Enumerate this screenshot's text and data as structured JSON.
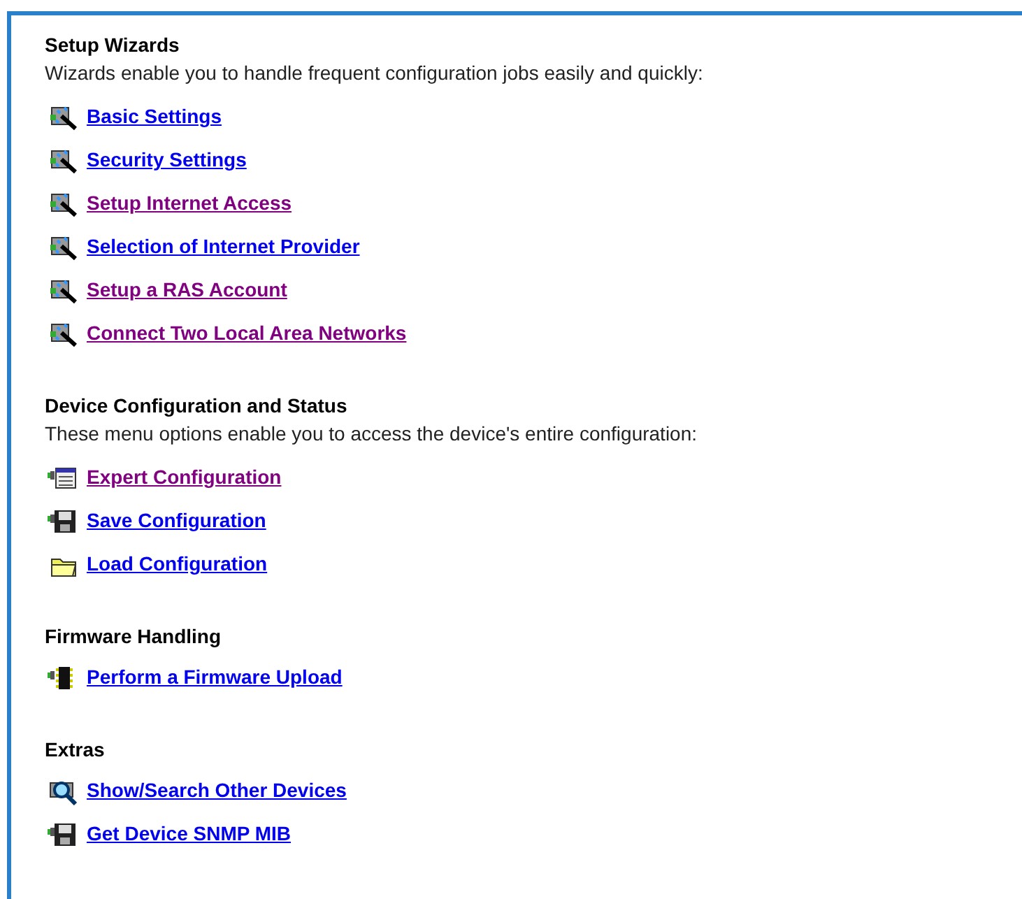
{
  "sections": [
    {
      "heading": "Setup Wizards",
      "description": "Wizards enable you to handle frequent configuration jobs easily and quickly:",
      "links": [
        {
          "label": "Basic Settings",
          "kind": "wizard",
          "visited": false
        },
        {
          "label": "Security Settings",
          "kind": "wizard",
          "visited": false
        },
        {
          "label": "Setup Internet Access",
          "kind": "wizard",
          "visited": true
        },
        {
          "label": "Selection of Internet Provider",
          "kind": "wizard",
          "visited": false
        },
        {
          "label": "Setup a RAS Account",
          "kind": "wizard",
          "visited": true
        },
        {
          "label": "Connect Two Local Area Networks",
          "kind": "wizard",
          "visited": true
        }
      ]
    },
    {
      "heading": "Device Configuration and Status",
      "description": "These menu options enable you to access the device's entire configuration:",
      "links": [
        {
          "label": "Expert Configuration",
          "kind": "expert",
          "visited": true
        },
        {
          "label": "Save Configuration",
          "kind": "save",
          "visited": false
        },
        {
          "label": "Load Configuration",
          "kind": "load",
          "visited": false
        }
      ]
    },
    {
      "heading": "Firmware Handling",
      "links": [
        {
          "label": "Perform a Firmware Upload",
          "kind": "firmware",
          "visited": false
        }
      ]
    },
    {
      "heading": "Extras",
      "links": [
        {
          "label": "Show/Search Other Devices",
          "kind": "search",
          "visited": false
        },
        {
          "label": "Get Device SNMP MIB",
          "kind": "save",
          "visited": false
        }
      ]
    }
  ]
}
